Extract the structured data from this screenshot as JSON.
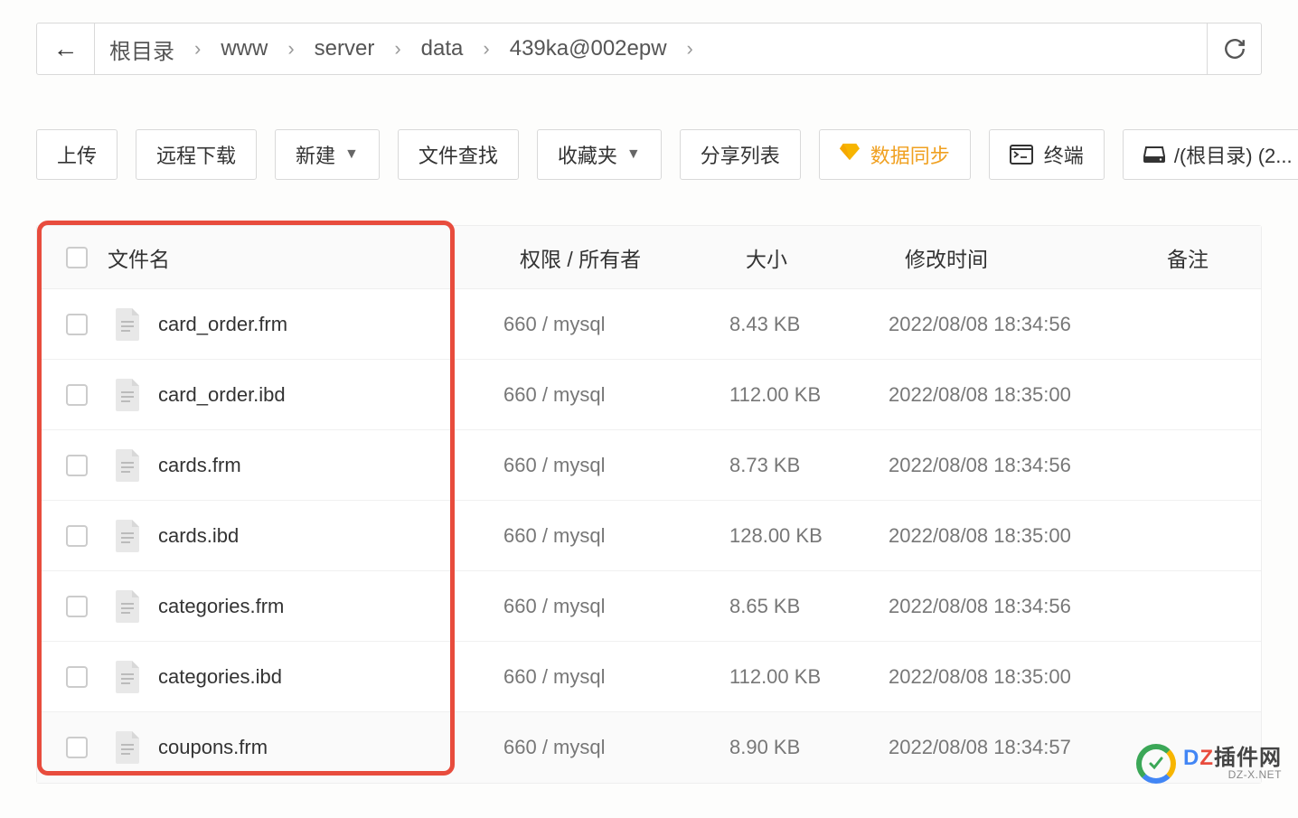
{
  "breadcrumb": {
    "items": [
      "根目录",
      "www",
      "server",
      "data",
      "439ka@002epw"
    ]
  },
  "toolbar": {
    "upload": "上传",
    "remote_download": "远程下载",
    "new": "新建",
    "file_search": "文件查找",
    "favorites": "收藏夹",
    "share_list": "分享列表",
    "data_sync": "数据同步",
    "terminal": "终端",
    "disk": "/(根目录) (2..."
  },
  "table": {
    "headers": {
      "name": "文件名",
      "perm": "权限 / 所有者",
      "size": "大小",
      "mtime": "修改时间",
      "note": "备注"
    },
    "rows": [
      {
        "name": "card_order.frm",
        "perm": "660 / mysql",
        "size": "8.43 KB",
        "mtime": "2022/08/08 18:34:56"
      },
      {
        "name": "card_order.ibd",
        "perm": "660 / mysql",
        "size": "112.00 KB",
        "mtime": "2022/08/08 18:35:00"
      },
      {
        "name": "cards.frm",
        "perm": "660 / mysql",
        "size": "8.73 KB",
        "mtime": "2022/08/08 18:34:56"
      },
      {
        "name": "cards.ibd",
        "perm": "660 / mysql",
        "size": "128.00 KB",
        "mtime": "2022/08/08 18:35:00"
      },
      {
        "name": "categories.frm",
        "perm": "660 / mysql",
        "size": "8.65 KB",
        "mtime": "2022/08/08 18:34:56"
      },
      {
        "name": "categories.ibd",
        "perm": "660 / mysql",
        "size": "112.00 KB",
        "mtime": "2022/08/08 18:35:00"
      },
      {
        "name": "coupons.frm",
        "perm": "660 / mysql",
        "size": "8.90 KB",
        "mtime": "2022/08/08 18:34:57"
      }
    ]
  },
  "watermark": {
    "main_d": "D",
    "main_z": "Z",
    "main_rest": "插件网",
    "sub": "DZ-X.NET"
  }
}
